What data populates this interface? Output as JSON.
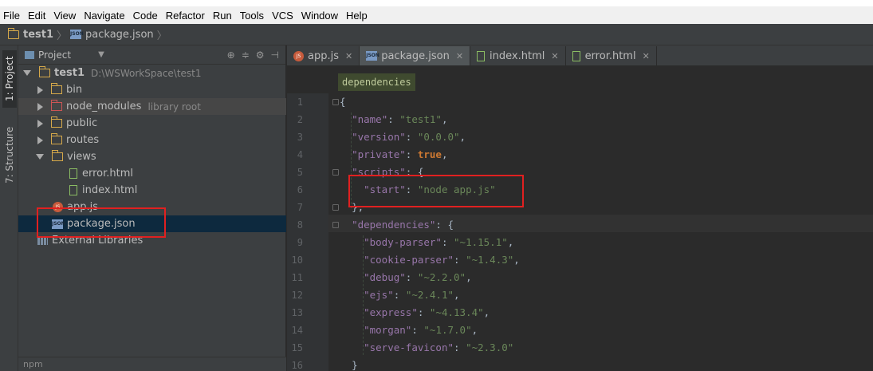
{
  "menu": [
    "File",
    "Edit",
    "View",
    "Navigate",
    "Code",
    "Refactor",
    "Run",
    "Tools",
    "VCS",
    "Window",
    "Help"
  ],
  "breadcrumb": {
    "project": "test1",
    "file": "package.json"
  },
  "side_tabs": {
    "project": "1: Project",
    "structure": "7: Structure"
  },
  "project_panel": {
    "title": "Project",
    "root": {
      "name": "test1",
      "path": "D:\\WSWorkSpace\\test1"
    },
    "items": [
      {
        "label": "bin",
        "note": ""
      },
      {
        "label": "node_modules",
        "note": "library root"
      },
      {
        "label": "public",
        "note": ""
      },
      {
        "label": "routes",
        "note": ""
      },
      {
        "label": "views",
        "note": ""
      },
      {
        "label": "error.html",
        "note": ""
      },
      {
        "label": "index.html",
        "note": ""
      },
      {
        "label": "app.js",
        "note": ""
      },
      {
        "label": "package.json",
        "note": ""
      },
      {
        "label": "External Libraries",
        "note": ""
      }
    ],
    "bottom": "npm"
  },
  "tabs": [
    {
      "label": "app.js"
    },
    {
      "label": "package.json"
    },
    {
      "label": "index.html"
    },
    {
      "label": "error.html"
    }
  ],
  "editor": {
    "crumb": "dependencies",
    "line_numbers": [
      "1",
      "2",
      "3",
      "4",
      "5",
      "6",
      "7",
      "8",
      "9",
      "10",
      "11",
      "12",
      "13",
      "14",
      "15",
      "16"
    ]
  },
  "code": {
    "l1": "{",
    "l2k": "\"name\"",
    "l2v": "\"test1\"",
    "l3k": "\"version\"",
    "l3v": "\"0.0.0\"",
    "l4k": "\"private\"",
    "l4v": "true",
    "l5k": "\"scripts\"",
    "l6k": "\"start\"",
    "l6v": "\"node app.js\"",
    "l7": "},",
    "l8k": "\"dependencies\"",
    "l9k": "\"body-parser\"",
    "l9v": "\"~1.15.1\"",
    "l10k": "\"cookie-parser\"",
    "l10v": "\"~1.4.3\"",
    "l11k": "\"debug\"",
    "l11v": "\"~2.2.0\"",
    "l12k": "\"ejs\"",
    "l12v": "\"~2.4.1\"",
    "l13k": "\"express\"",
    "l13v": "\"~4.13.4\"",
    "l14k": "\"morgan\"",
    "l14v": "\"~1.7.0\"",
    "l15k": "\"serve-favicon\"",
    "l15v": "\"~2.3.0\"",
    "l16": "}"
  }
}
